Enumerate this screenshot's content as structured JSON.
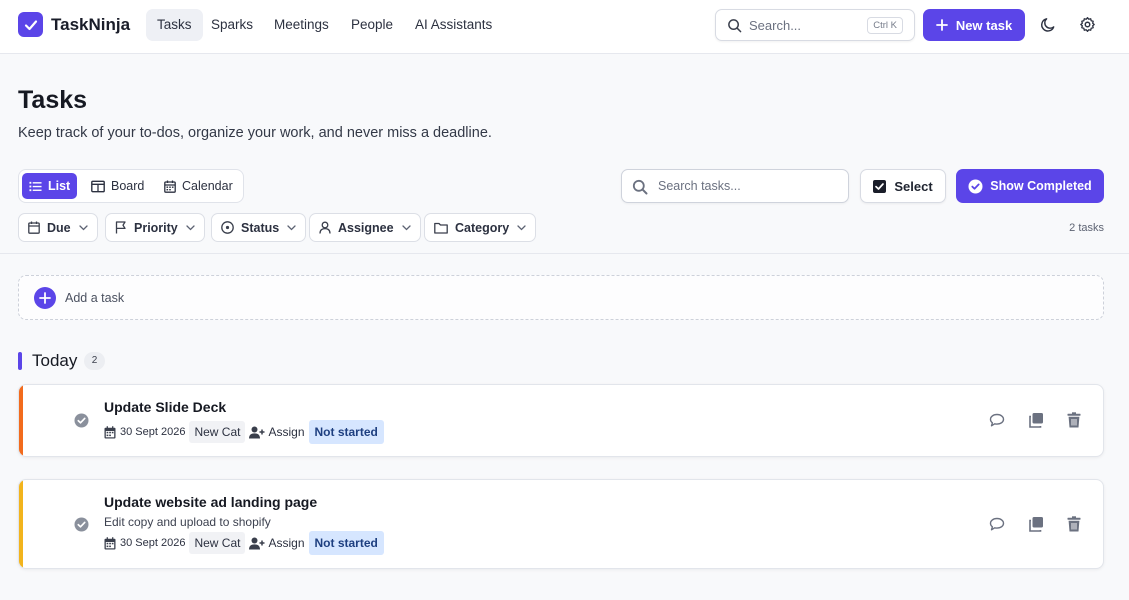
{
  "app": {
    "name": "TaskNinja",
    "accent": "#5b45e8"
  },
  "nav": {
    "links": [
      {
        "label": "Tasks",
        "active": true
      },
      {
        "label": "Sparks",
        "active": false
      },
      {
        "label": "Meetings",
        "active": false
      },
      {
        "label": "People",
        "active": false
      },
      {
        "label": "AI Assistants",
        "active": false
      }
    ],
    "search_placeholder": "Search...",
    "search_shortcut": "Ctrl K",
    "new_task_label": "New task"
  },
  "page": {
    "title": "Tasks",
    "subtitle": "Keep track of your to-dos, organize your work, and never miss a deadline."
  },
  "toolbar": {
    "views": [
      {
        "label": "List",
        "icon": "list-icon",
        "active": true
      },
      {
        "label": "Board",
        "icon": "board-icon",
        "active": false
      },
      {
        "label": "Calendar",
        "icon": "calendar-icon",
        "active": false
      }
    ],
    "search_placeholder": "Search tasks...",
    "select_label": "Select",
    "show_completed_label": "Show Completed"
  },
  "filters": [
    {
      "label": "Due",
      "icon": "calendar-icon"
    },
    {
      "label": "Priority",
      "icon": "flag-icon"
    },
    {
      "label": "Status",
      "icon": "status-circle-icon"
    },
    {
      "label": "Assignee",
      "icon": "user-icon"
    },
    {
      "label": "Category",
      "icon": "folder-icon"
    }
  ],
  "task_count": "2 tasks",
  "add_task_label": "Add a task",
  "group": {
    "title": "Today",
    "count": "2",
    "tasks": [
      {
        "title": "Update Slide Deck",
        "description": "",
        "date": "30 Sept 2026",
        "category": "New Cat",
        "assign_label": "Assign",
        "status": "Not started",
        "priority_color": "#f26b1d"
      },
      {
        "title": "Update website ad landing page",
        "description": "Edit copy and upload to shopify",
        "date": "30 Sept 2026",
        "category": "New Cat",
        "assign_label": "Assign",
        "status": "Not started",
        "priority_color": "#f2b41d"
      }
    ]
  }
}
